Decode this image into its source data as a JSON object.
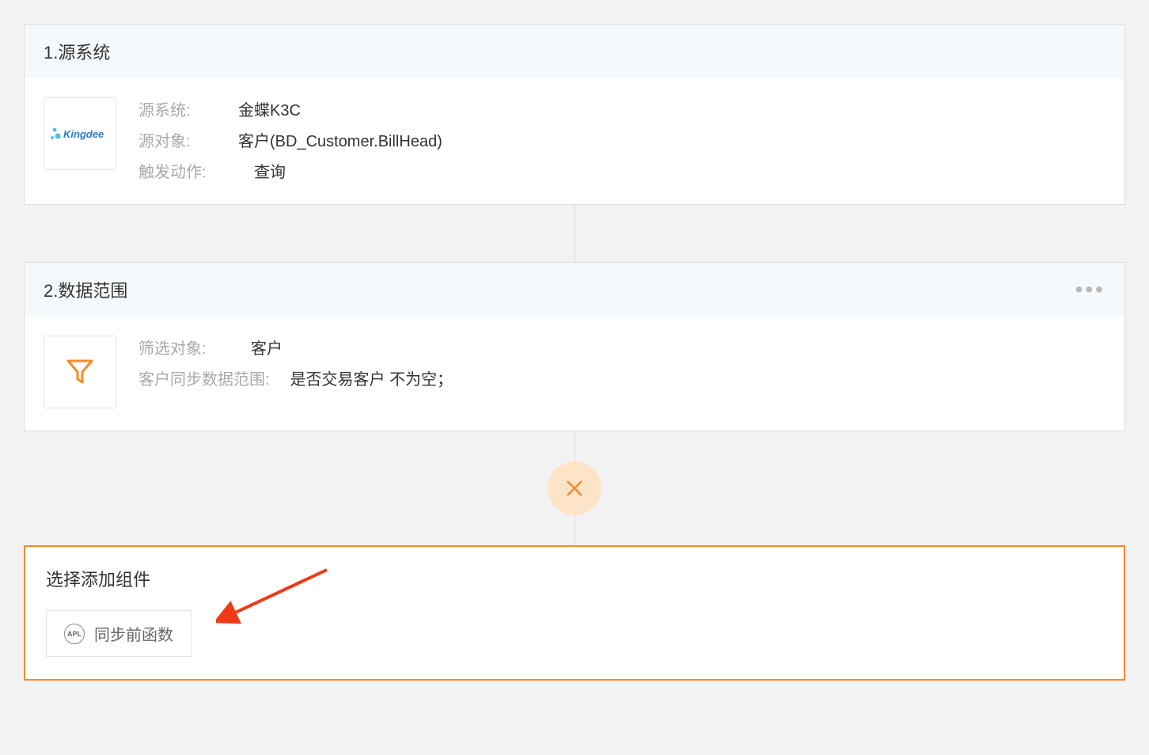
{
  "step1": {
    "title": "1.源系统",
    "logo_text": "Kingdee",
    "fields": {
      "source_system_label": "源系统:",
      "source_system_value": "金蝶K3C",
      "source_object_label": "源对象:",
      "source_object_value": "客户(BD_Customer.BillHead)",
      "trigger_action_label": "触发动作:",
      "trigger_action_value": "查询"
    }
  },
  "step2": {
    "title": "2.数据范围",
    "fields": {
      "filter_object_label": "筛选对象:",
      "filter_object_value": "客户",
      "sync_range_label": "客户同步数据范围:",
      "sync_range_value": "是否交易客户 不为空；"
    }
  },
  "add_section": {
    "title": "选择添加组件",
    "apl_badge": "APL",
    "component_label": "同步前函数"
  },
  "icons": {
    "more": "more-icon",
    "close": "close-icon",
    "filter": "filter-icon",
    "apl": "apl-icon"
  },
  "colors": {
    "accent": "#f38b2b",
    "accent_light": "#fde3c8",
    "border": "#dcdcdc",
    "muted": "#a9a9a9"
  }
}
